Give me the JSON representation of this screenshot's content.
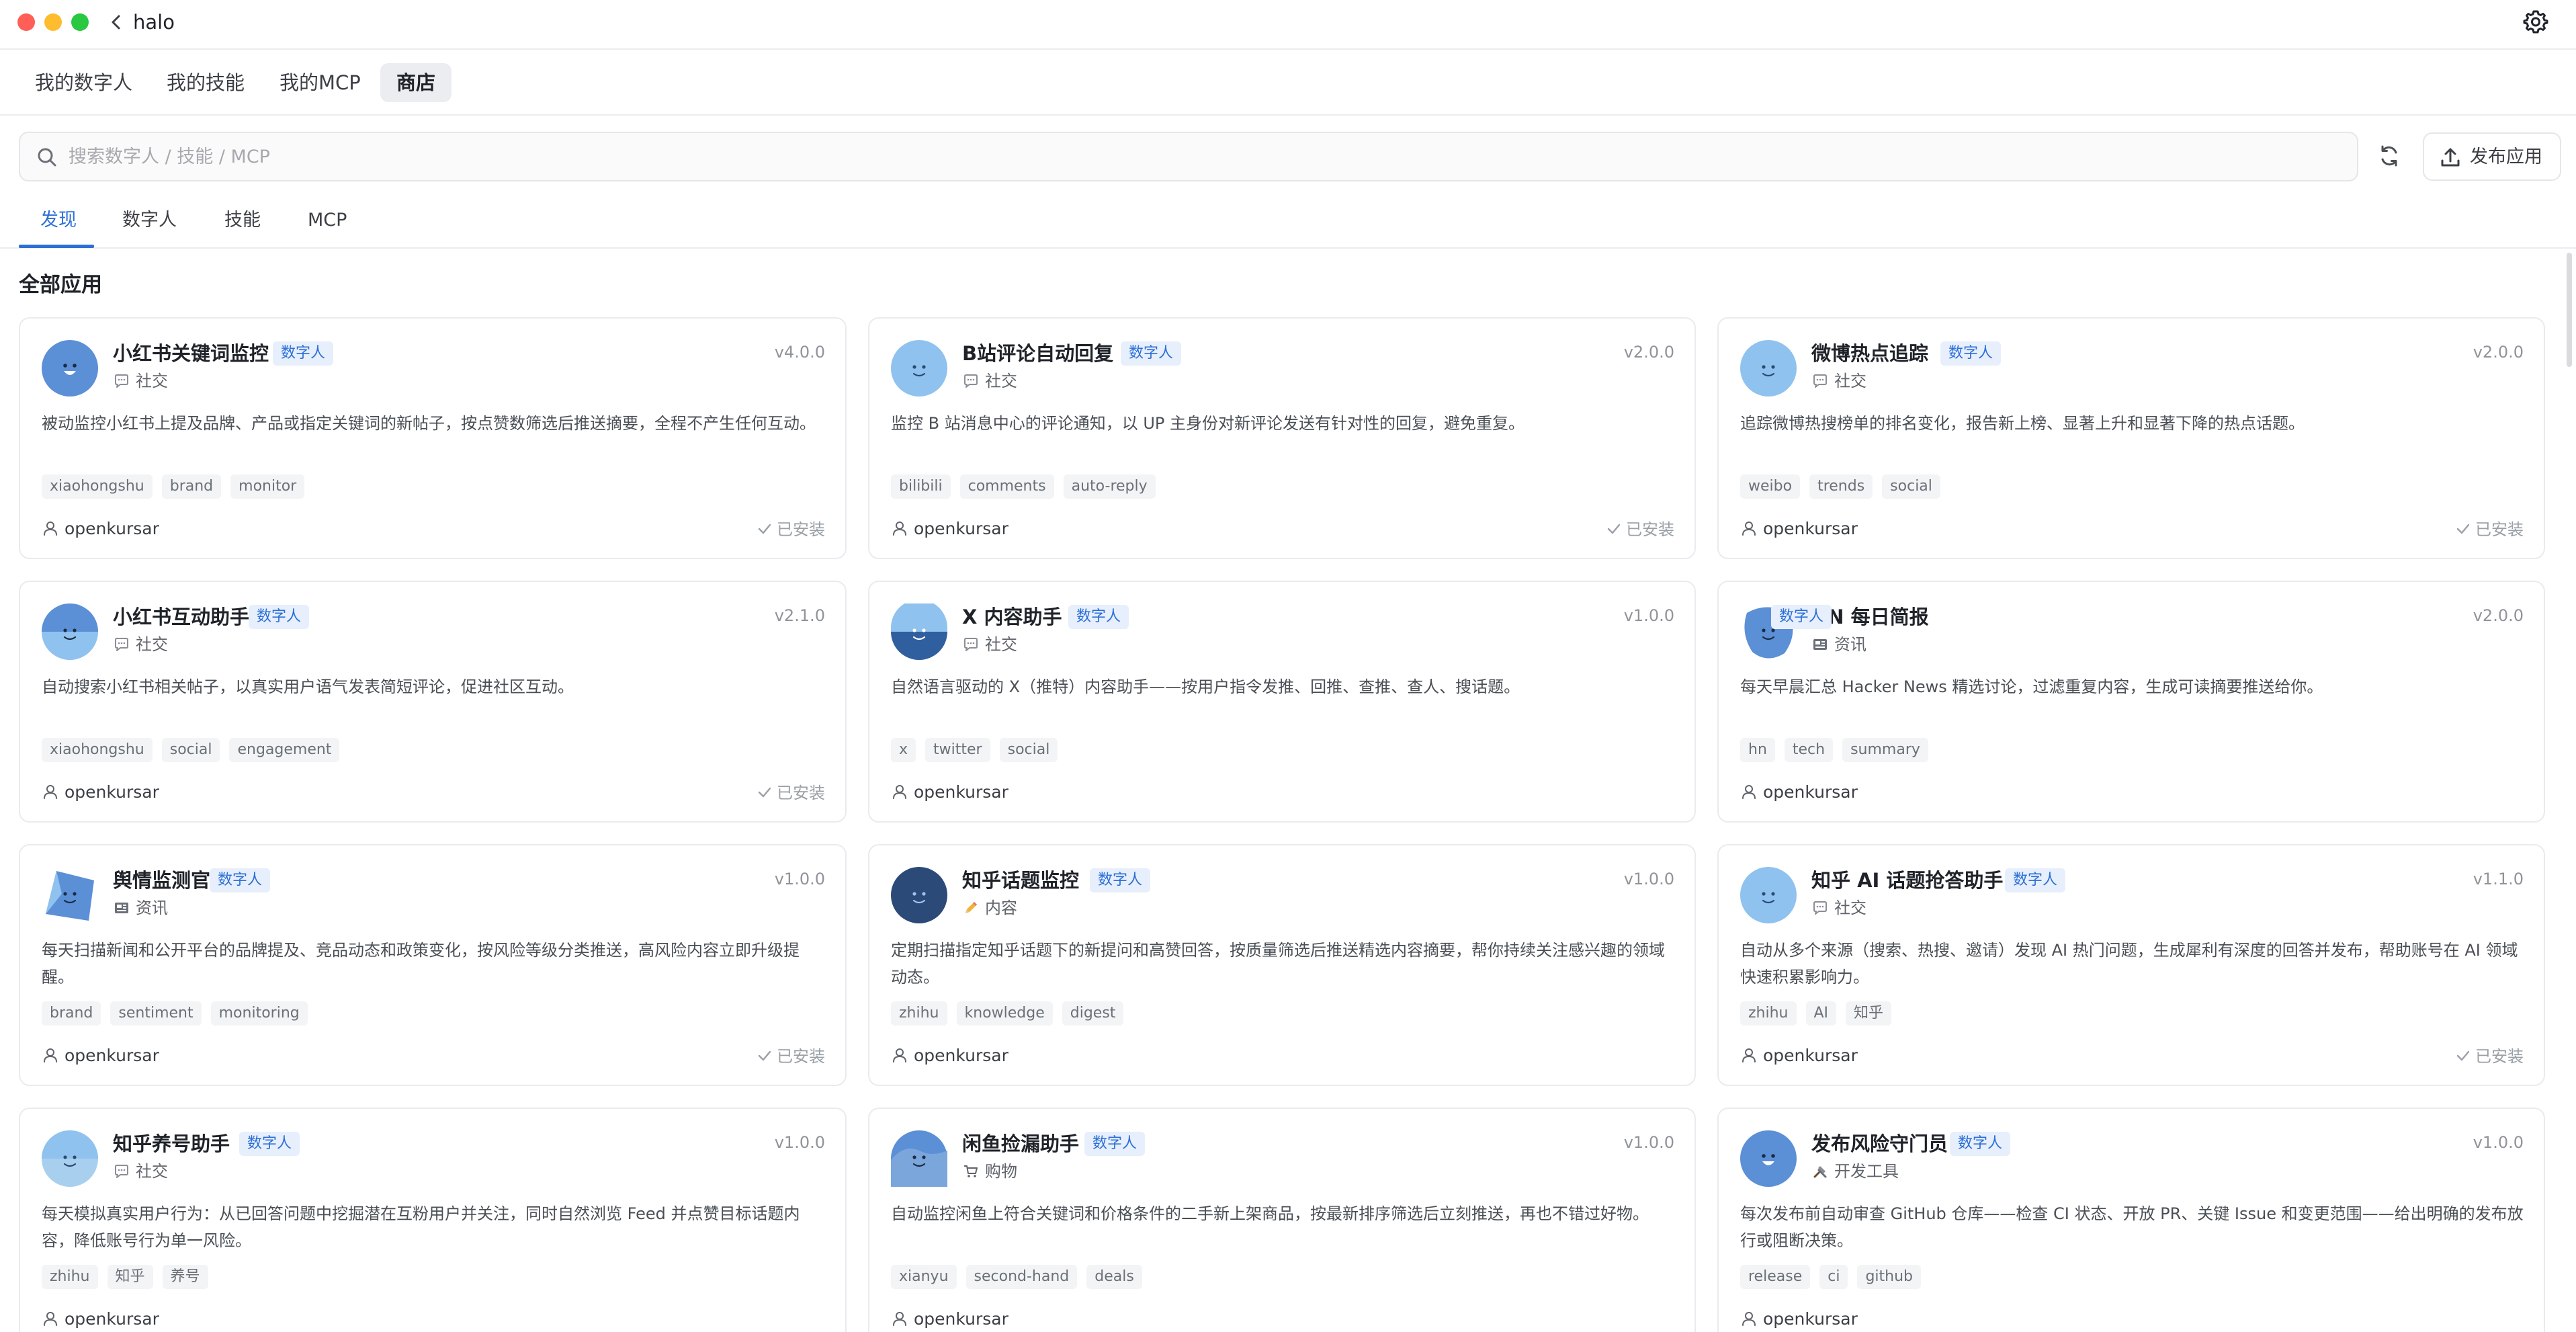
{
  "window": {
    "title": "halo"
  },
  "topnav": {
    "items": [
      "我的数字人",
      "我的技能",
      "我的MCP",
      "商店"
    ],
    "active_index": 3
  },
  "search": {
    "placeholder": "搜索数字人 / 技能 / MCP",
    "value": ""
  },
  "toolbar": {
    "publish_label": "发布应用"
  },
  "subtabs": {
    "items": [
      "发现",
      "数字人",
      "技能",
      "MCP"
    ],
    "active_index": 0
  },
  "section": {
    "title": "全部应用"
  },
  "colors": {
    "accent": "#2b6fd6",
    "badge_bg": "#e7effc",
    "avatar_blue": "#5b8fd6",
    "avatar_light": "#8fc2ee",
    "avatar_dark": "#2f5f9e"
  },
  "cards": [
    {
      "name": "小红书关键词监控",
      "badge": "数字人",
      "version": "v4.0.0",
      "category_icon": "speech-bubble-icon",
      "category": "社交",
      "description": "被动监控小红书上提及品牌、产品或指定关键词的新帖子，按点赞数筛选后推送摘要，全程不产生任何互动。",
      "tags": [
        "xiaohongshu",
        "brand",
        "monitor"
      ],
      "author": "openkursar",
      "installed": "已安装",
      "avatar_style": "blue-round"
    },
    {
      "name": "B站评论自动回复",
      "badge": "数字人",
      "version": "v2.0.0",
      "category_icon": "speech-bubble-icon",
      "category": "社交",
      "description": "监控 B 站消息中心的评论通知，以 UP 主身份对新评论发送有针对性的回复，避免重复。",
      "tags": [
        "bilibili",
        "comments",
        "auto-reply"
      ],
      "author": "openkursar",
      "installed": "已安装",
      "avatar_style": "light-round"
    },
    {
      "name": "微博热点追踪",
      "badge": "数字人",
      "version": "v2.0.0",
      "category_icon": "speech-bubble-icon",
      "category": "社交",
      "description": "追踪微博热搜榜单的排名变化，报告新上榜、显著上升和显著下降的热点话题。",
      "tags": [
        "weibo",
        "trends",
        "social"
      ],
      "author": "openkursar",
      "installed": "已安装",
      "avatar_style": "light-round"
    },
    {
      "name": "小红书互动助手",
      "badge": "数字人",
      "version": "v2.1.0",
      "category_icon": "speech-bubble-icon",
      "category": "社交",
      "description": "自动搜索小红书相关帖子，以真实用户语气发表简短评论，促进社区互动。",
      "tags": [
        "xiaohongshu",
        "social",
        "engagement"
      ],
      "author": "openkursar",
      "installed": "已安装",
      "avatar_style": "split"
    },
    {
      "name": "X 内容助手",
      "badge": "数字人",
      "version": "v1.0.0",
      "category_icon": "speech-bubble-icon",
      "category": "社交",
      "description": "自然语言驱动的 X（推特）内容助手——按用户指令发推、回推、查推、查人、搜话题。",
      "tags": [
        "x",
        "twitter",
        "social"
      ],
      "author": "openkursar",
      "installed": "",
      "avatar_style": "dark-split"
    },
    {
      "name": "HN 每日简报",
      "badge": "数字人",
      "version": "v2.0.0",
      "category_icon": "newspaper-icon",
      "category": "资讯",
      "description": "每天早晨汇总 Hacker News 精选讨论，过滤重复内容，生成可读摘要推送给你。",
      "tags": [
        "hn",
        "tech",
        "summary"
      ],
      "author": "openkursar",
      "installed": "",
      "avatar_style": "blob"
    },
    {
      "name": "舆情监测官",
      "badge": "数字人",
      "version": "v1.0.0",
      "category_icon": "newspaper-icon",
      "category": "资讯",
      "description": "每天扫描新闻和公开平台的品牌提及、竞品动态和政策变化，按风险等级分类推送，高风险内容立即升级提醒。",
      "tags": [
        "brand",
        "sentiment",
        "monitoring"
      ],
      "author": "openkursar",
      "installed": "已安装",
      "avatar_style": "tilted"
    },
    {
      "name": "知乎话题监控",
      "badge": "数字人",
      "version": "v1.0.0",
      "category_icon": "pencil-icon",
      "category": "内容",
      "description": "定期扫描指定知乎话题下的新提问和高赞回答，按质量筛选后推送精选内容摘要，帮你持续关注感兴趣的领域动态。",
      "tags": [
        "zhihu",
        "knowledge",
        "digest"
      ],
      "author": "openkursar",
      "installed": "",
      "avatar_style": "dark-round"
    },
    {
      "name": "知乎 AI 话题抢答助手",
      "badge": "数字人",
      "version": "v1.1.0",
      "category_icon": "speech-bubble-icon",
      "category": "社交",
      "description": "自动从多个来源（搜索、热搜、邀请）发现 AI 热门问题，生成犀利有深度的回答并发布，帮助账号在 AI 领域快速积累影响力。",
      "tags": [
        "zhihu",
        "AI",
        "知乎"
      ],
      "author": "openkursar",
      "installed": "已安装",
      "avatar_style": "light-round"
    },
    {
      "name": "知乎养号助手",
      "badge": "数字人",
      "version": "v1.0.0",
      "category_icon": "speech-bubble-icon",
      "category": "社交",
      "description": "每天模拟真实用户行为：从已回答问题中挖掘潜在互粉用户并关注，同时自然浏览 Feed 并点赞目标话题内容，降低账号行为单一风险。",
      "tags": [
        "zhihu",
        "知乎",
        "养号"
      ],
      "author": "openkursar",
      "installed": "",
      "avatar_style": "split-light"
    },
    {
      "name": "闲鱼捡漏助手",
      "badge": "数字人",
      "version": "v1.0.0",
      "category_icon": "cart-icon",
      "category": "购物",
      "description": "自动监控闲鱼上符合关键词和价格条件的二手新上架商品，按最新排序筛选后立刻推送，再也不错过好物。",
      "tags": [
        "xianyu",
        "second-hand",
        "deals"
      ],
      "author": "openkursar",
      "installed": "",
      "avatar_style": "fish"
    },
    {
      "name": "发布风险守门员",
      "badge": "数字人",
      "version": "v1.0.0",
      "category_icon": "tools-icon",
      "category": "开发工具",
      "description": "每次发布前自动审查 GitHub 仓库——检查 CI 状态、开放 PR、关键 Issue 和变更范围——给出明确的发布放行或阻断决策。",
      "tags": [
        "release",
        "ci",
        "github"
      ],
      "author": "openkursar",
      "installed": "",
      "avatar_style": "blue-round"
    }
  ]
}
